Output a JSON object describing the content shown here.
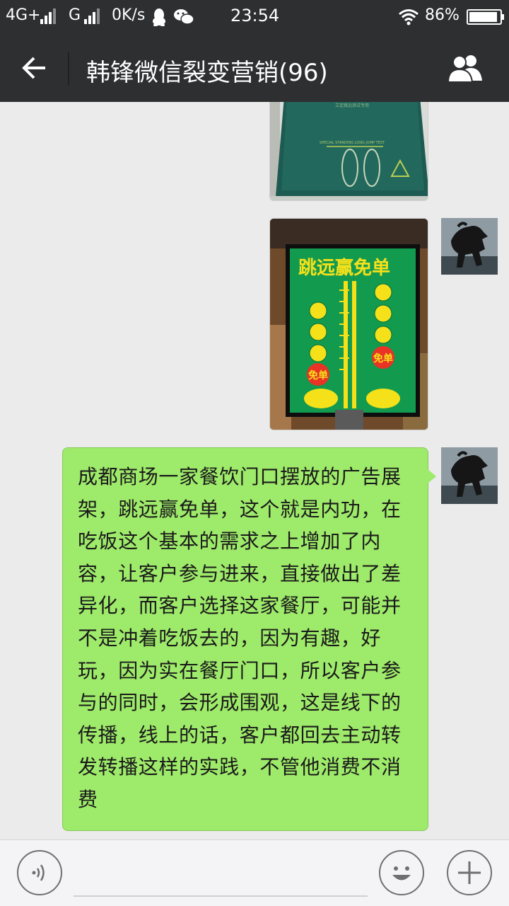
{
  "status_bar": {
    "network1": "4G+",
    "network2": "G",
    "speed": "0K/s",
    "time": "23:54",
    "battery": "86%",
    "icons": [
      "signal-icon",
      "qq-icon",
      "wechat-icon",
      "wifi-icon",
      "battery-icon"
    ]
  },
  "header": {
    "title": "韩锋微信裂变营销(96)",
    "back_icon": "back-arrow-icon",
    "members_icon": "group-members-icon"
  },
  "messages": [
    {
      "type": "image",
      "sender": "self",
      "content": "photo of green long-jump mat with footprints",
      "print_text": "SPECIAL STANDING LONG JUMP TEST",
      "print_text_top": "立定跳远测试专用"
    },
    {
      "type": "image",
      "sender": "self",
      "content": "photo of green restaurant poster",
      "poster_title": "跳远赢免单",
      "badge": "免单"
    },
    {
      "type": "text",
      "sender": "self",
      "text": "成都商场一家餐饮门口摆放的广告展架，跳远赢免单，这个就是内功，在吃饭这个基本的需求之上增加了内容，让客户参与进来，直接做出了差异化，而客户选择这家餐厅，可能并不是冲着吃饭去的，因为有趣，好玩，因为实在餐厅门口，所以客户参与的同时，会形成围观，这是线下的传播，线上的话，客户都回去主动转发转播这样的实践，不管他消费不消费"
    }
  ],
  "input_bar": {
    "placeholder": "",
    "icons": [
      "voice-icon",
      "emoji-icon",
      "plus-icon"
    ]
  },
  "colors": {
    "header_bg": "#2d2f31",
    "chat_bg": "#ebebeb",
    "bubble_bg": "#9eea6a",
    "poster_green": "#129a4f",
    "poster_yellow": "#f5e11a"
  }
}
